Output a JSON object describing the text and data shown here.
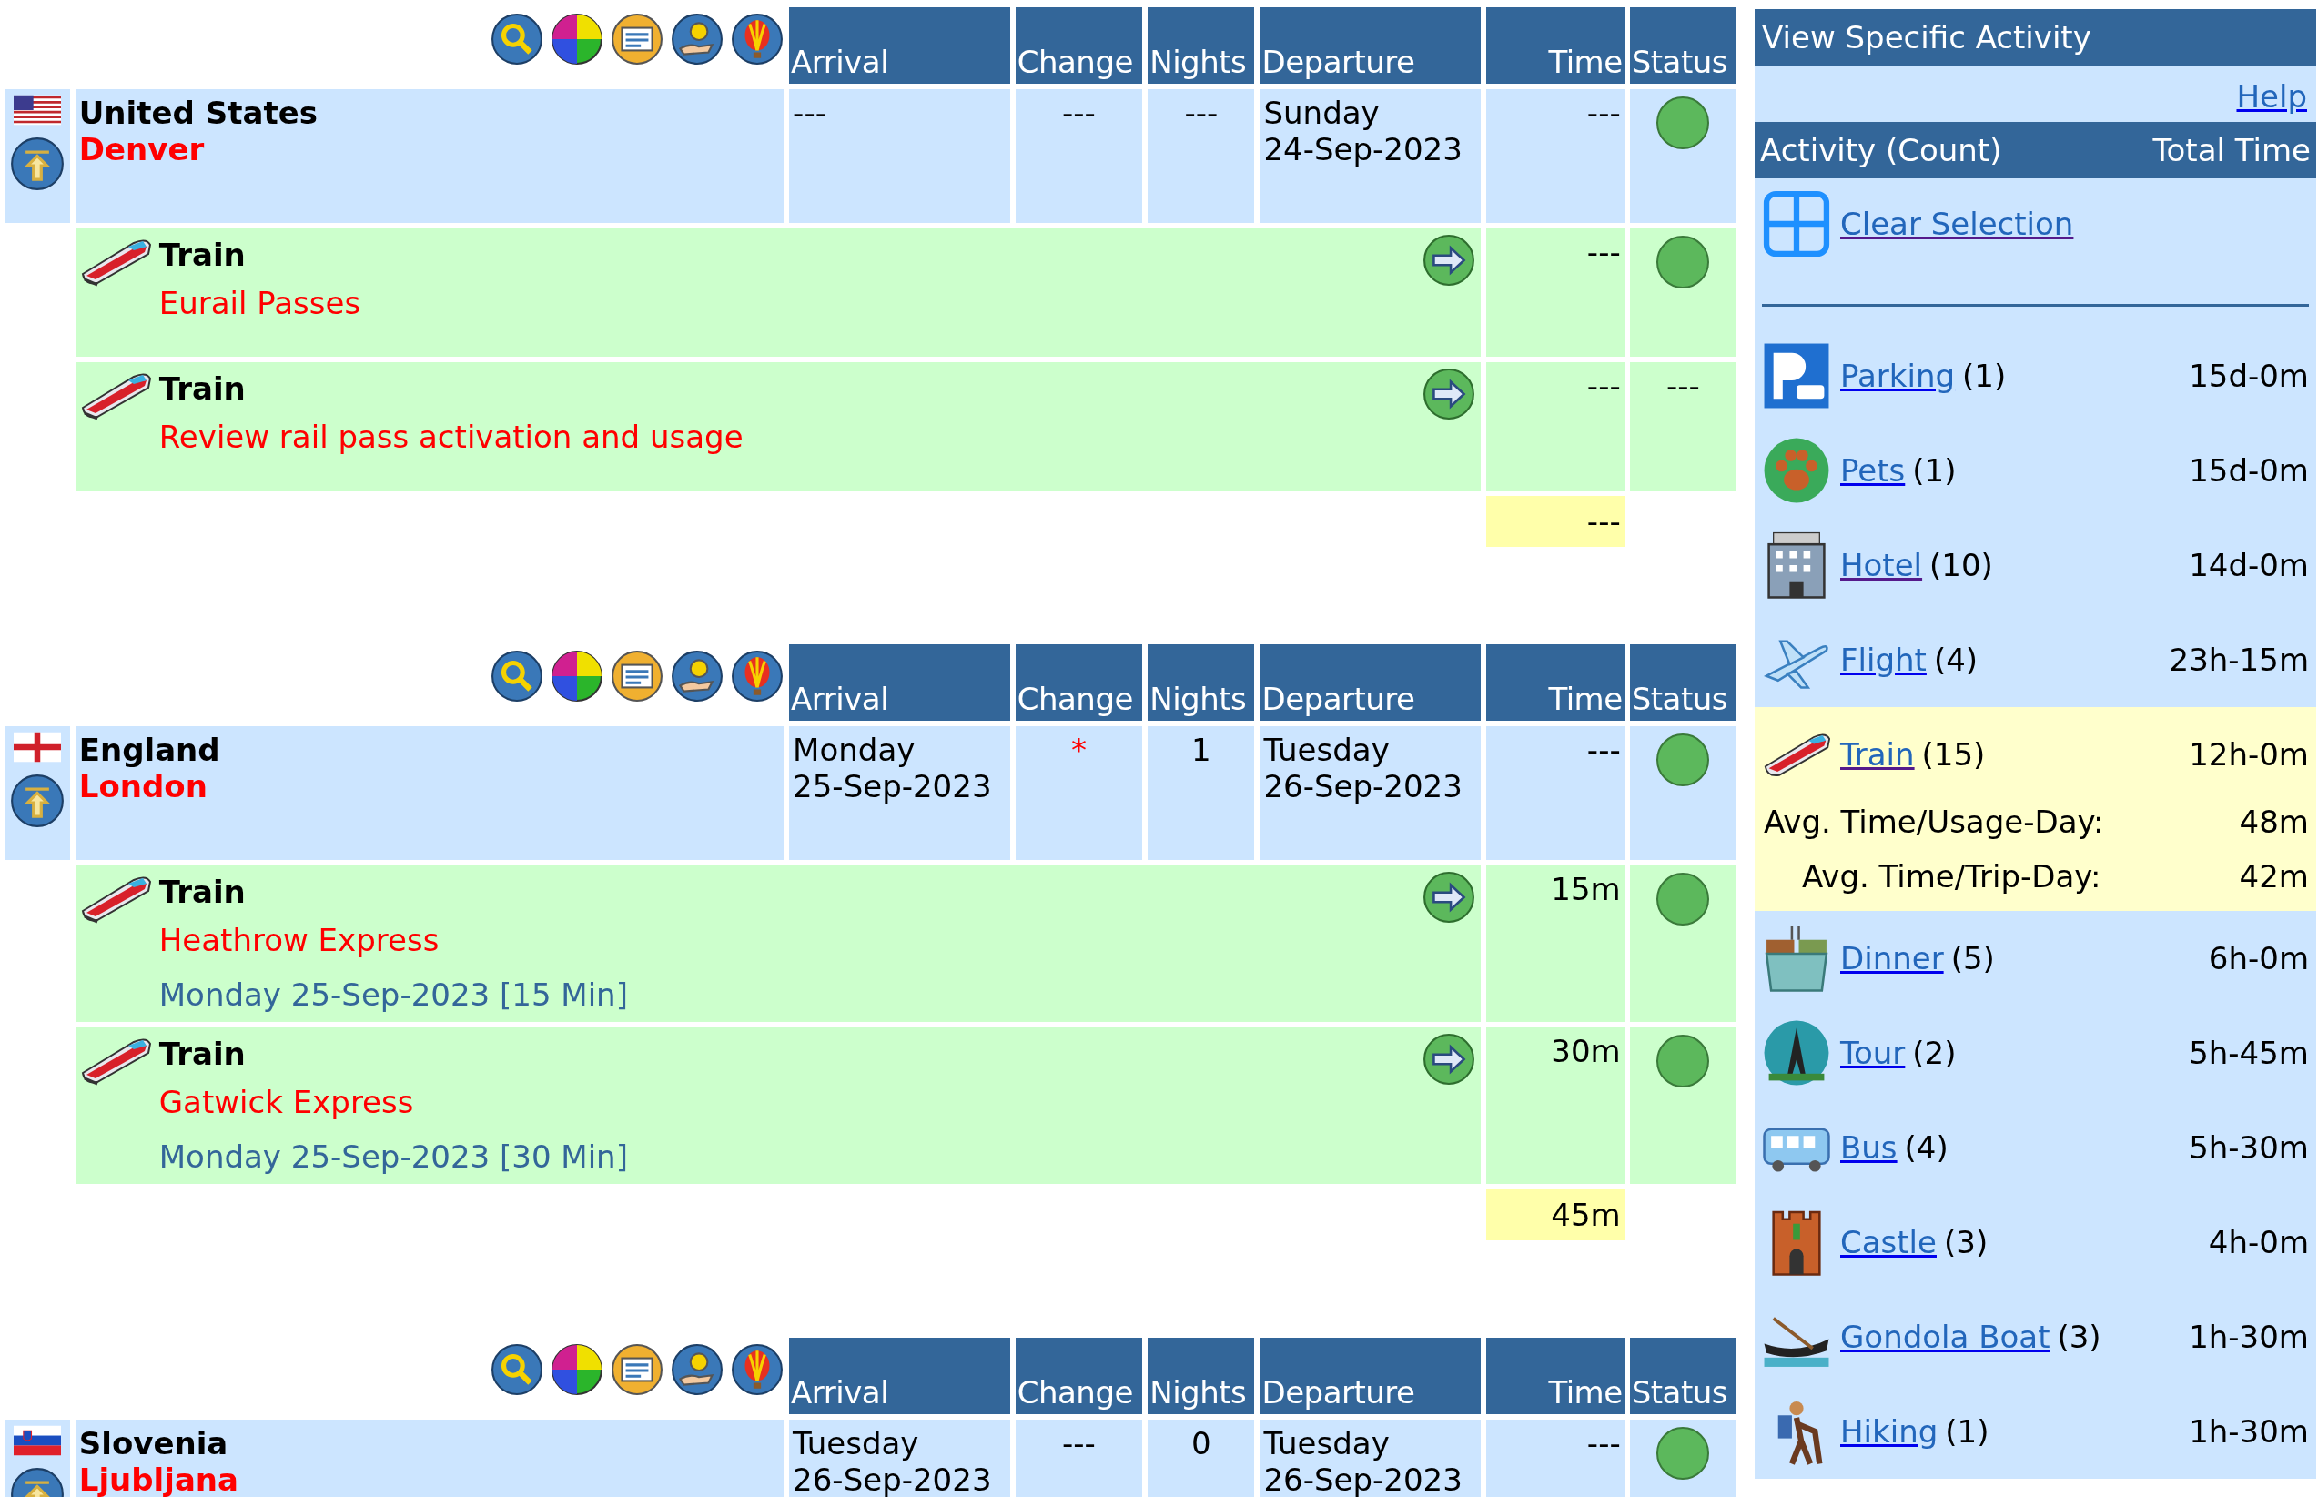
{
  "sections": [
    {
      "columns": [
        "Arrival",
        "Change",
        "Nights",
        "Departure",
        "Time",
        "Status"
      ],
      "kind": "us",
      "country": "United States",
      "city": "Denver",
      "arrival": [
        "---"
      ],
      "change": {
        "text": "---",
        "flagged": false
      },
      "nights": "---",
      "departure": [
        "Sunday",
        "24-Sep-2023"
      ],
      "time": "---",
      "status": {
        "kind": "dot"
      },
      "activities": [
        {
          "title": "Train",
          "name": "Eurail Passes",
          "time": "---",
          "status": {
            "kind": "dot"
          }
        },
        {
          "title": "Train",
          "name": "Review rail pass activation and usage",
          "time": "---",
          "status": {
            "kind": "text",
            "text": "---"
          }
        }
      ],
      "total": "---"
    },
    {
      "columns": [
        "Arrival",
        "Change",
        "Nights",
        "Departure",
        "Time",
        "Status"
      ],
      "kind": "england",
      "country": "England",
      "city": "London",
      "arrival": [
        "Monday",
        "25-Sep-2023"
      ],
      "change": {
        "text": "*",
        "flagged": true
      },
      "nights": "1",
      "departure": [
        "Tuesday",
        "26-Sep-2023"
      ],
      "time": "---",
      "status": {
        "kind": "dot"
      },
      "activities": [
        {
          "title": "Train",
          "name": "Heathrow Express",
          "detail": "Monday 25-Sep-2023 [15 Min]",
          "time": "15m",
          "status": {
            "kind": "dot"
          }
        },
        {
          "title": "Train",
          "name": "Gatwick Express",
          "detail": "Monday 25-Sep-2023 [30 Min]",
          "time": "30m",
          "status": {
            "kind": "dot"
          }
        }
      ],
      "total": "45m"
    },
    {
      "columns": [
        "Arrival",
        "Change",
        "Nights",
        "Departure",
        "Time",
        "Status"
      ],
      "kind": "slovenia",
      "country": "Slovenia",
      "city": "Ljubljana",
      "arrival": [
        "Tuesday",
        "26-Sep-2023"
      ],
      "change": {
        "text": "---",
        "flagged": false
      },
      "nights": "0",
      "departure": [
        "Tuesday",
        "26-Sep-2023"
      ],
      "time": "---",
      "status": {
        "kind": "dot"
      }
    }
  ],
  "sidebar": {
    "title": "View Specific Activity",
    "help": "Help",
    "columns": [
      "Activity (Count)",
      "Total Time"
    ],
    "clear": "Clear Selection",
    "items": [
      {
        "kind": "parking",
        "name": "Parking",
        "count": "(1)",
        "total": "15d-0m",
        "visited": false,
        "selected": false
      },
      {
        "kind": "pets",
        "name": "Pets",
        "count": "(1)",
        "total": "15d-0m",
        "visited": false,
        "selected": false
      },
      {
        "kind": "hotel",
        "name": "Hotel",
        "count": "(10)",
        "total": "14d-0m",
        "visited": true,
        "selected": false
      },
      {
        "kind": "flight",
        "name": "Flight",
        "count": "(4)",
        "total": "23h-15m",
        "visited": false,
        "selected": false
      },
      {
        "kind": "train",
        "name": "Train",
        "count": "(15)",
        "total": "12h-0m",
        "visited": true,
        "selected": true,
        "stats": [
          {
            "label": "Avg. Time/Usage-Day:",
            "value": "48m"
          },
          {
            "label": "Avg. Time/Trip-Day:",
            "value": "42m"
          }
        ]
      },
      {
        "kind": "dinner",
        "name": "Dinner",
        "count": "(5)",
        "total": "6h-0m",
        "visited": false,
        "selected": false
      },
      {
        "kind": "tour",
        "name": "Tour",
        "count": "(2)",
        "total": "5h-45m",
        "visited": false,
        "selected": false
      },
      {
        "kind": "bus",
        "name": "Bus",
        "count": "(4)",
        "total": "5h-30m",
        "visited": false,
        "selected": false
      },
      {
        "kind": "castle",
        "name": "Castle",
        "count": "(3)",
        "total": "4h-0m",
        "visited": false,
        "selected": false
      },
      {
        "kind": "gondola",
        "name": "Gondola Boat",
        "count": "(3)",
        "total": "1h-30m",
        "visited": false,
        "selected": false
      },
      {
        "kind": "hiking",
        "name": "Hiking",
        "count": "(1)",
        "total": "1h-30m",
        "visited": false,
        "selected": false
      }
    ]
  }
}
